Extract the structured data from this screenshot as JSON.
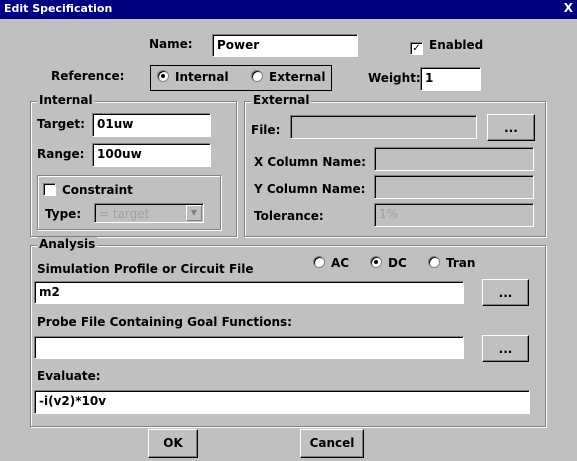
{
  "window": {
    "title": "Edit Specification",
    "close_glyph": "X"
  },
  "name": {
    "label": "Name:",
    "value": "Power"
  },
  "enabled": {
    "label": "Enabled",
    "checked": true
  },
  "reference": {
    "label": "Reference:",
    "internal": "Internal",
    "external": "External",
    "selected": "Internal"
  },
  "weight": {
    "label": "Weight:",
    "value": "1"
  },
  "internal": {
    "legend": "Internal",
    "target_label": "Target:",
    "target_value": "01uw",
    "range_label": "Range:",
    "range_value": "100uw",
    "constraint_label": "Constraint",
    "constraint_checked": false,
    "type_label": "Type:",
    "type_value": "= target"
  },
  "external": {
    "legend": "External",
    "file_label": "File:",
    "file_value": "",
    "browse": "...",
    "xcol_label": "X Column Name:",
    "xcol_value": "",
    "ycol_label": "Y Column Name:",
    "ycol_value": "",
    "tol_label": "Tolerance:",
    "tol_value": "1%"
  },
  "analysis": {
    "legend": "Analysis",
    "sim_label": "Simulation Profile or Circuit File",
    "ac": "AC",
    "dc": "DC",
    "tran": "Tran",
    "selected": "DC",
    "sim_value": "m2",
    "browse": "...",
    "probe_label": "Probe File Containing Goal Functions:",
    "probe_value": "",
    "evaluate_label": "Evaluate:",
    "evaluate_value": "-i(v2)*10v"
  },
  "buttons": {
    "ok": "OK",
    "cancel": "Cancel"
  }
}
